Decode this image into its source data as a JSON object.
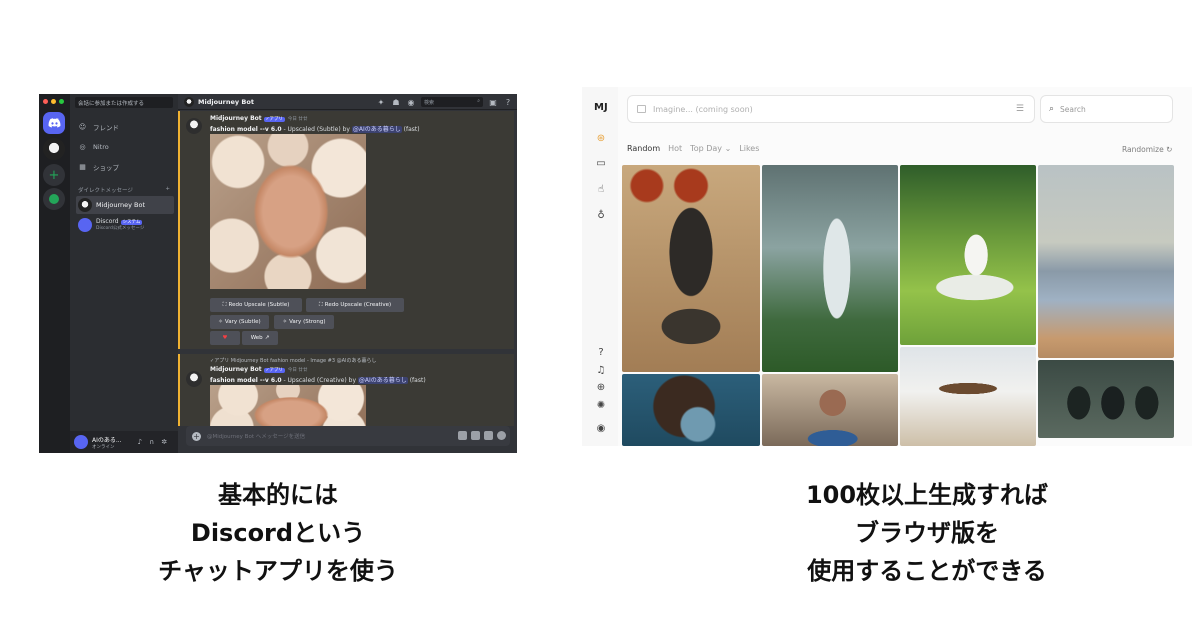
{
  "discord": {
    "dm_search_placeholder": "会話に参加または作成する",
    "nav": {
      "friends": "フレンド",
      "nitro": "Nitro",
      "shop": "ショップ"
    },
    "dm_section": "ダイレクトメッセージ",
    "dms": [
      {
        "name": "Midjourney Bot"
      },
      {
        "name": "Discord",
        "tag": "システム",
        "sub": "Discord公式メッセージ"
      }
    ],
    "user": {
      "name": "AIのある...",
      "status": "オンライン"
    },
    "channel_title": "Midjourney Bot",
    "header_search": "検索",
    "messages": [
      {
        "author": "Midjourney Bot",
        "tag": "✓アプリ",
        "time": "今日 廿廿",
        "prompt_bold": "fashion model --v 6.0",
        "prompt_rest": " - Upscaled (Subtle) by ",
        "mention": "@AIのある暮らし",
        "speed": " (fast)"
      },
      {
        "reply": "✓アプリ  Midjourney Bot fashion model - Image #3 @AIのある暮らし",
        "author": "Midjourney Bot",
        "tag": "✓アプリ",
        "time": "今日 廿廿",
        "prompt_bold": "fashion model --v 6.0",
        "prompt_rest": " - Upscaled (Creative) by ",
        "mention": "@AIのある暮らし",
        "speed": " (fast)"
      }
    ],
    "buttons": {
      "redo_subtle": "Redo Upscale (Subtle)",
      "redo_creative": "Redo Upscale (Creative)",
      "vary_subtle": "Vary (Subtle)",
      "vary_strong": "Vary (Strong)",
      "web": "Web"
    },
    "input_placeholder": "@Midjourney Bot へメッセージを送信"
  },
  "midjourney": {
    "logo": "MJ",
    "imagine_placeholder": "Imagine... (coming soon)",
    "search_placeholder": "Search",
    "tabs": [
      "Random",
      "Hot",
      "Top Day",
      "Likes"
    ],
    "active_tab": "Random",
    "randomize": "Randomize"
  },
  "captions": {
    "left": [
      "基本的には",
      "Discordという",
      "チャットアプリを使う"
    ],
    "right": [
      "100枚以上生成すれば",
      "ブラウザ版を",
      "使用することができる"
    ]
  },
  "colors": {
    "discord_bg": "#313338",
    "discord_blurple": "#5865f2",
    "mj_accent": "#e8a33d"
  }
}
